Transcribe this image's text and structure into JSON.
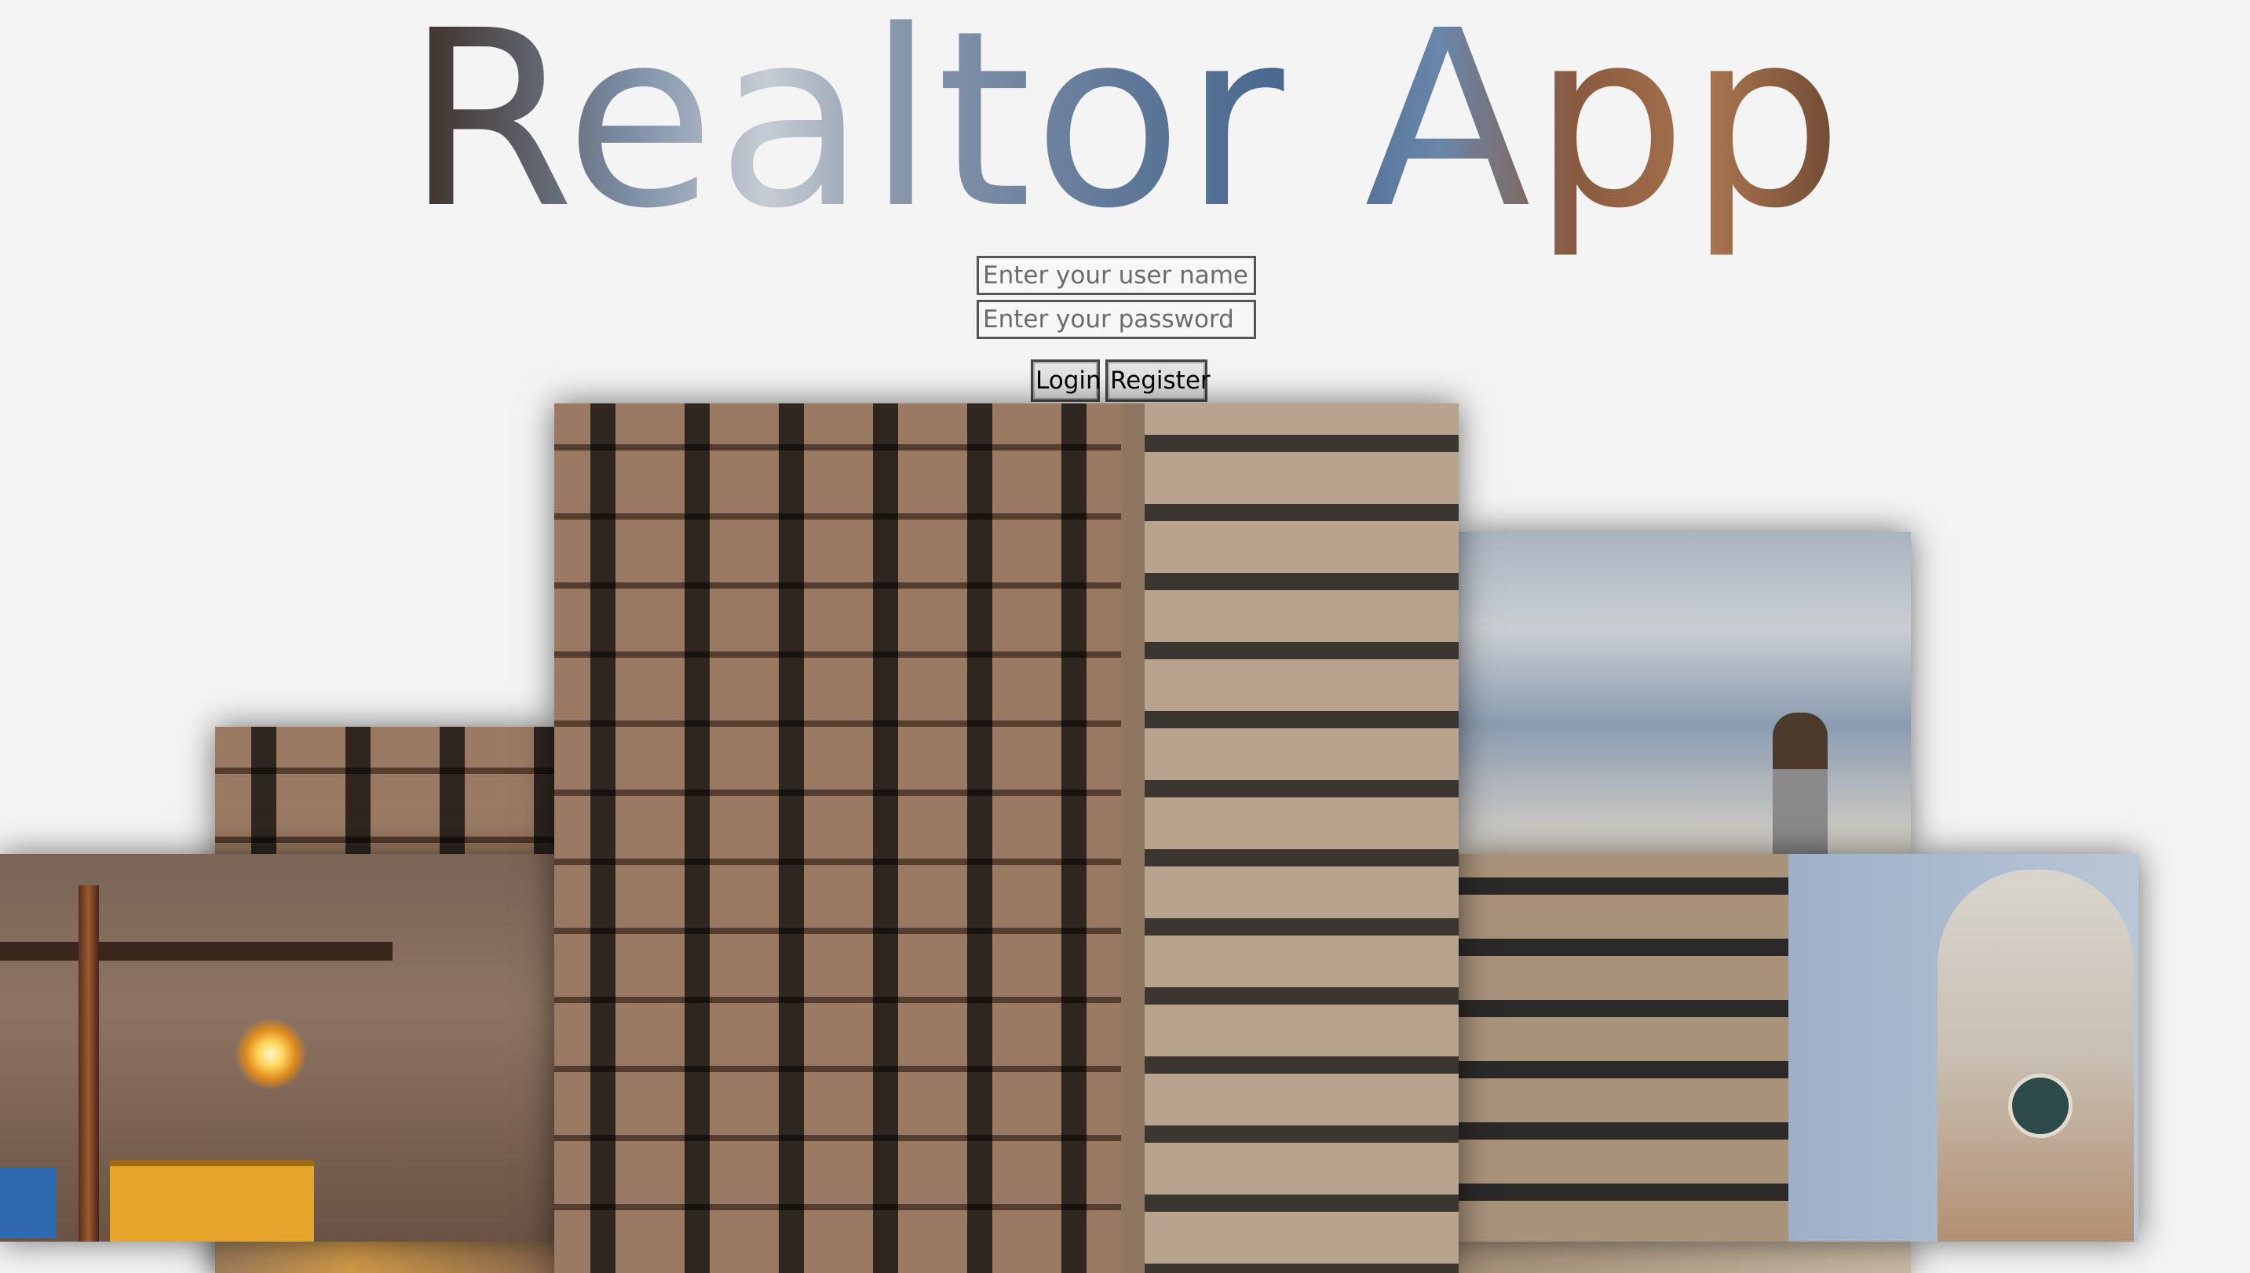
{
  "app": {
    "title": "Realtor App"
  },
  "login_form": {
    "username_placeholder": "Enter your user name",
    "password_placeholder": "Enter your password",
    "login_label": "Login",
    "register_label": "Register"
  },
  "colors": {
    "background": "#f4f4f4",
    "input_border": "#555555",
    "button_bg": "#e4e4e4"
  },
  "images": [
    {
      "name": "city-building-facade-photo"
    },
    {
      "name": "street-lamp-building-photo"
    },
    {
      "name": "sky-statue-photo"
    },
    {
      "name": "city-hall-tower-photo"
    }
  ]
}
